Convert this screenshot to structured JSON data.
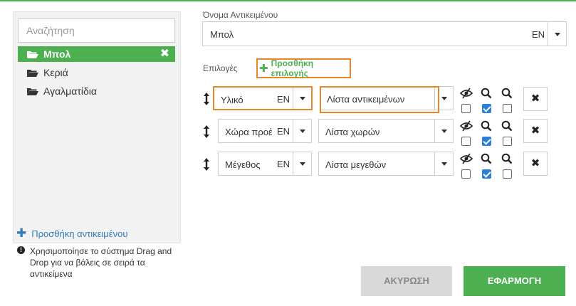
{
  "sidebar": {
    "search_placeholder": "Αναζήτηση",
    "items": [
      {
        "label": "Μπολ",
        "active": true
      },
      {
        "label": "Κεριά",
        "active": false
      },
      {
        "label": "Αγαλματίδια",
        "active": false
      }
    ],
    "add_label": "Προσθήκη αντικειμένου",
    "info_text": "Χρησιμοποίησε το σύστημα Drag and Drop για να βάλεις σε σειρά τα αντικείμενα"
  },
  "form": {
    "name_label": "Όνομα Αντικειμένου",
    "name_value": "Μπολ",
    "name_lang": "EN",
    "options_label": "Επιλογές",
    "add_option_label": "Προσθήκη επιλογής"
  },
  "options": [
    {
      "name": "Υλικό",
      "lang": "EN",
      "list": "Λίστα αντικειμένων",
      "visible": false,
      "searchable": true,
      "filter": false
    },
    {
      "name": "Χώρα προέλευσης",
      "lang": "EN",
      "list": "Λίστα χωρών",
      "visible": false,
      "searchable": true,
      "filter": false
    },
    {
      "name": "Μέγεθος",
      "lang": "EN",
      "list": "Λίστα μεγεθών",
      "visible": false,
      "searchable": true,
      "filter": false
    }
  ],
  "footer": {
    "cancel_label": "ΑΚΥΡΩΣΗ",
    "apply_label": "ΕΦΑΡΜΟΓΗ"
  },
  "colors": {
    "accent": "#4caf50",
    "highlight": "#e6862b",
    "link": "#337ab7",
    "checkbox": "#2b7fd6"
  }
}
